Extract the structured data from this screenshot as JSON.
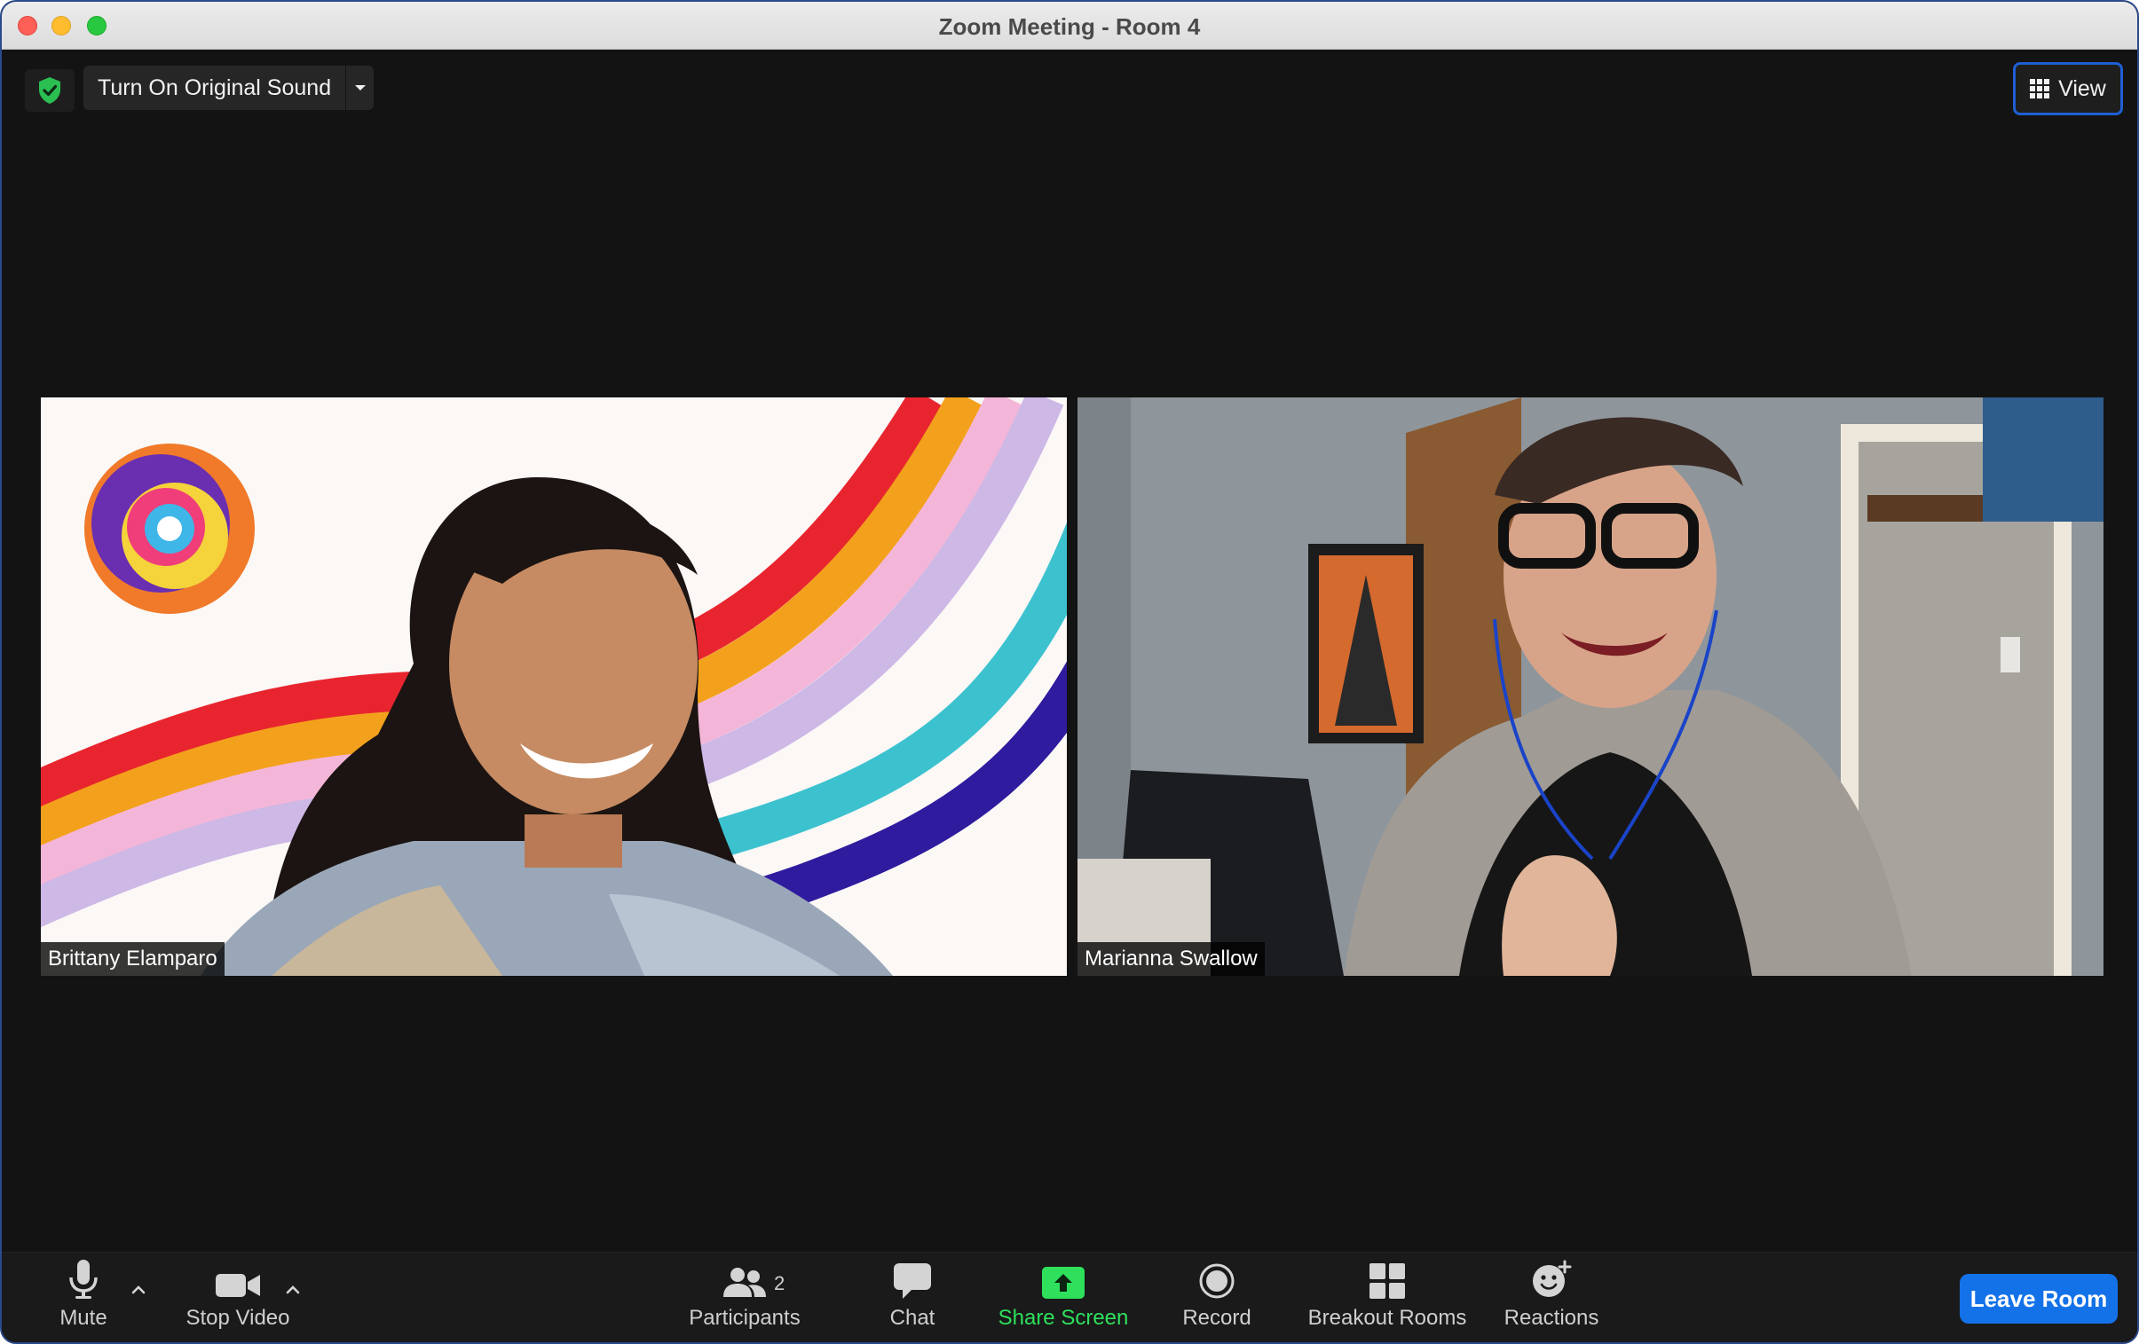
{
  "window": {
    "title": "Zoom Meeting - Room 4"
  },
  "top_bar": {
    "original_sound_label": "Turn On Original Sound",
    "view_label": "View"
  },
  "participants": [
    {
      "name": "Brittany Elamparo"
    },
    {
      "name": "Marianna Swallow"
    }
  ],
  "toolbar": {
    "mute_label": "Mute",
    "stop_video_label": "Stop Video",
    "participants_label": "Participants",
    "participants_count": "2",
    "chat_label": "Chat",
    "share_screen_label": "Share Screen",
    "record_label": "Record",
    "breakout_rooms_label": "Breakout Rooms",
    "reactions_label": "Reactions",
    "leave_label": "Leave Room"
  },
  "colors": {
    "accent_blue": "#1472e8",
    "share_green": "#2ee05c",
    "security_green": "#2bbf52"
  }
}
